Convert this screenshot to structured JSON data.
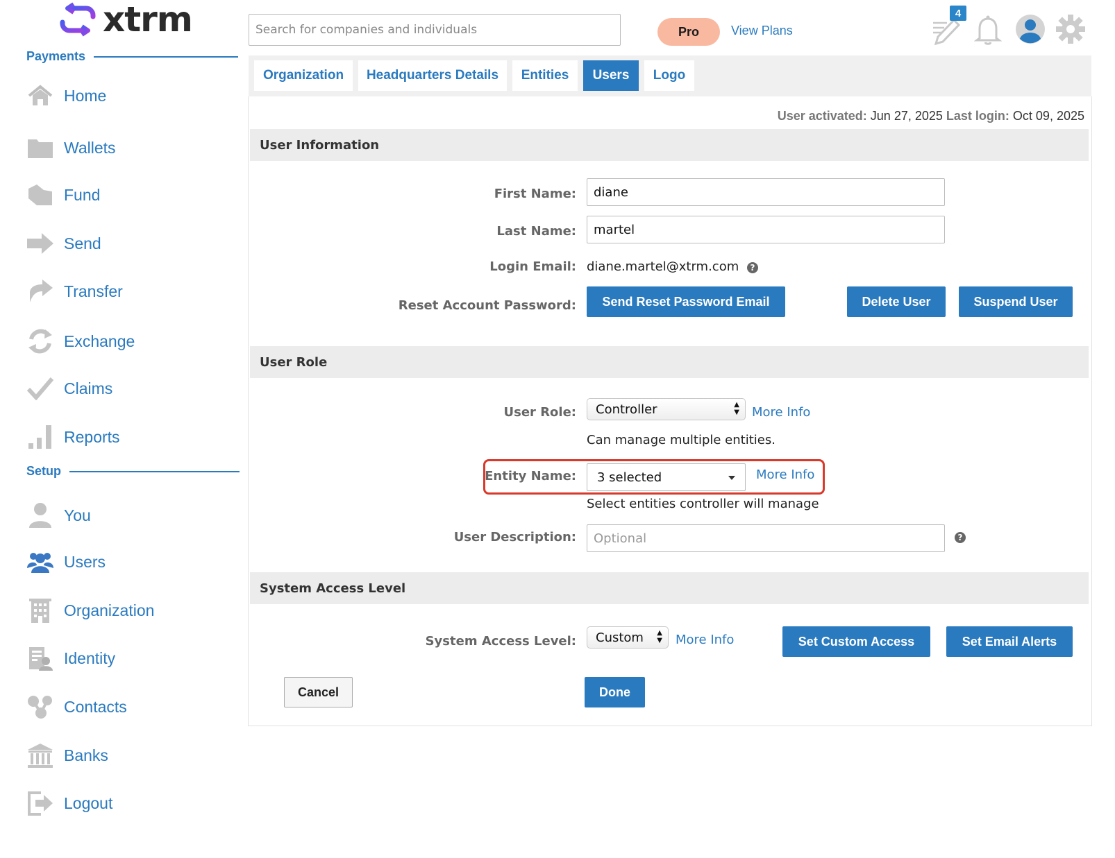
{
  "brand": {
    "name": "xtrm"
  },
  "sidebar": {
    "sections": [
      {
        "title": "Payments"
      },
      {
        "title": "Setup"
      }
    ],
    "items": [
      {
        "label": "Home",
        "icon": "home-icon"
      },
      {
        "label": "Wallets",
        "icon": "folder-icon"
      },
      {
        "label": "Fund",
        "icon": "fund-icon"
      },
      {
        "label": "Send",
        "icon": "send-arrow-icon"
      },
      {
        "label": "Transfer",
        "icon": "transfer-icon"
      },
      {
        "label": "Exchange",
        "icon": "exchange-icon"
      },
      {
        "label": "Claims",
        "icon": "checkmark-icon"
      },
      {
        "label": "Reports",
        "icon": "bar-chart-icon"
      },
      {
        "label": "You",
        "icon": "person-icon"
      },
      {
        "label": "Users",
        "icon": "users-group-icon"
      },
      {
        "label": "Organization",
        "icon": "building-icon"
      },
      {
        "label": "Identity",
        "icon": "identity-icon"
      },
      {
        "label": "Contacts",
        "icon": "contacts-icon"
      },
      {
        "label": "Banks",
        "icon": "bank-icon"
      },
      {
        "label": "Logout",
        "icon": "logout-icon"
      }
    ]
  },
  "header": {
    "search_placeholder": "Search for companies and individuals",
    "plan_badge": "Pro",
    "view_plans": "View Plans",
    "notes_count": "4",
    "icons": [
      "edit-pen-icon",
      "bell-icon",
      "profile-avatar-icon",
      "gear-icon"
    ]
  },
  "tabs": [
    {
      "label": "Organization",
      "active": false
    },
    {
      "label": "Headquarters Details",
      "active": false
    },
    {
      "label": "Entities",
      "active": false
    },
    {
      "label": "Users",
      "active": true
    },
    {
      "label": "Logo",
      "active": false
    }
  ],
  "status": {
    "activated_label": "User activated:",
    "activated_value": "Jun 27, 2025",
    "login_label": "Last login:",
    "login_value": "Oct 09, 2025"
  },
  "user_info": {
    "title": "User Information",
    "first_name_label": "First Name:",
    "first_name": "diane",
    "last_name_label": "Last Name:",
    "last_name": "martel",
    "email_label": "Login Email:",
    "email": "diane.martel@xtrm.com",
    "reset_label": "Reset Account Password:",
    "reset_button": "Send Reset Password Email",
    "delete_button": "Delete User",
    "suspend_button": "Suspend User"
  },
  "user_role": {
    "title": "User Role",
    "role_label": "User Role:",
    "role_value": "Controller",
    "role_more": "More Info",
    "role_desc": "Can manage multiple entities.",
    "entity_label": "Entity Name:",
    "entity_value": "3 selected",
    "entity_more": "More Info",
    "entity_desc": "Select entities controller will manage",
    "desc_label": "User Description:",
    "desc_placeholder": "Optional"
  },
  "access": {
    "title": "System Access Level",
    "label": "System Access Level:",
    "value": "Custom",
    "more": "More Info",
    "custom_button": "Set Custom Access",
    "alerts_button": "Set Email Alerts"
  },
  "actions": {
    "cancel": "Cancel",
    "done": "Done"
  },
  "colors": {
    "accent": "#2a7abf",
    "pro_badge": "#f9b9a1",
    "highlight": "#d9392b",
    "logo": "#7b3fe4"
  }
}
